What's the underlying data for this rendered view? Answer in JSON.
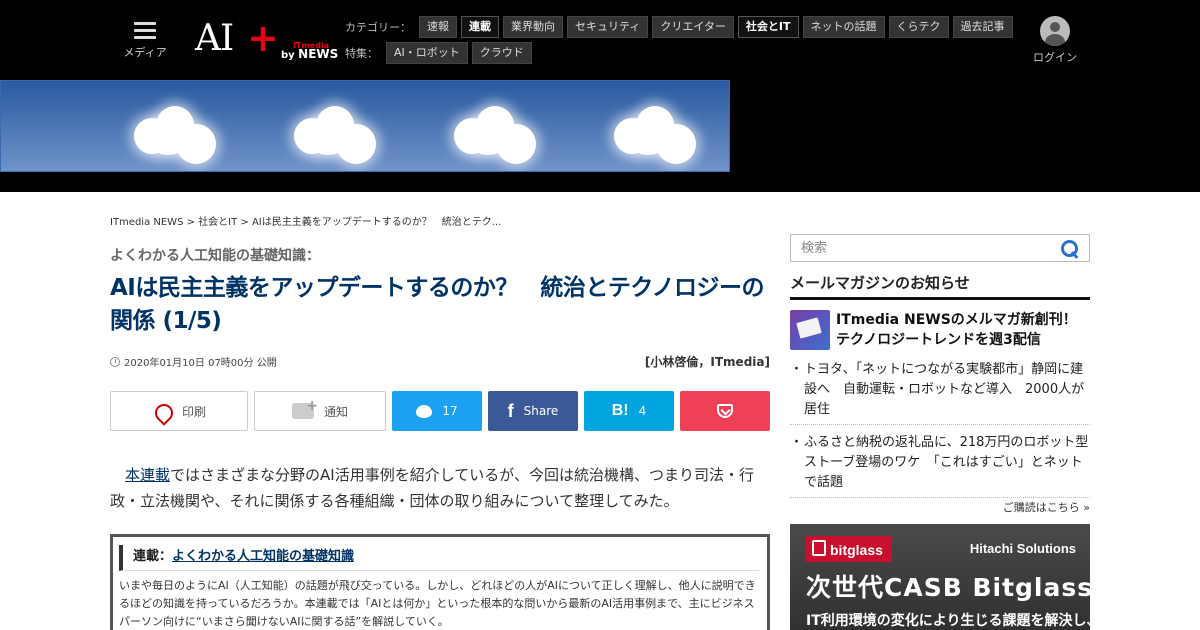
{
  "header": {
    "menu_label": "メディア",
    "logo": {
      "main": "AI",
      "plus": "+",
      "sub_top": "ITmedia",
      "sub_by": "by",
      "sub_news": "NEWS"
    },
    "nav_category_label": "カテゴリー：",
    "nav_categories": [
      {
        "label": "速報",
        "active": false
      },
      {
        "label": "連載",
        "active": true
      },
      {
        "label": "業界動向",
        "active": false
      },
      {
        "label": "セキュリティ",
        "active": false
      },
      {
        "label": "クリエイター",
        "active": false
      },
      {
        "label": "社会とIT",
        "active": true
      },
      {
        "label": "ネットの話題",
        "active": false
      },
      {
        "label": "くらテク",
        "active": false
      },
      {
        "label": "過去記事",
        "active": false
      }
    ],
    "nav_feature_label": "特集：",
    "nav_features": [
      {
        "label": "AI・ロボット"
      },
      {
        "label": "クラウド"
      }
    ],
    "login_label": "ログイン"
  },
  "breadcrumb": "ITmedia NEWS > 社会とIT > AIは民主主義をアップデートするのか？　統治とテク...",
  "article": {
    "series_label": "よくわかる人工知能の基礎知識：",
    "title": "AIは民主主義をアップデートするのか？　統治とテクノロジーの関係 (1/5)",
    "date": "2020年01月10日 07時00分 公開",
    "author": "[小林啓倫，ITmedia]",
    "share": {
      "print": "印刷",
      "notify": "通知",
      "twitter_count": "17",
      "facebook": "Share",
      "hatena_count": "4"
    },
    "lead_link": "本連載",
    "lead_rest": "ではさまざまな分野のAI活用事例を紹介しているが、今回は統治機構、つまり司法・行政・立法機関や、それに関係する各種組織・団体の取り組みについて整理してみた。",
    "series_box": {
      "head_prefix": "連載：",
      "head_link": "よくわかる人工知能の基礎知識",
      "desc": "いまや毎日のようにAI（人工知能）の話題が飛び交っている。しかし、どれほどの人がAIについて正しく理解し、他人に説明できるほどの知識を持っているだろうか。本連載では「AIとは何か」といった根本的な問いから最新のAI活用事例まで、主にビジネスパーソン向けに“いまさら聞けないAIに関する話”を解説していく。"
    }
  },
  "sidebar": {
    "search_placeholder": "検索",
    "mailmag_title": "メールマガジンのお知らせ",
    "mailmag_feature": "ITmedia NEWSのメルマガ新創刊！ テクノロジートレンドを週3配信",
    "mailmag_items": [
      "トヨタ、「ネットにつながる実験都市」静岡に建設へ　自動運転・ロボットなど導入　2000人が居住",
      "ふるさと納税の返礼品に、218万円のロボット型ストーブ登場のワケ　「これはすごい」とネットで話題"
    ],
    "mailmag_more": "ご購読はこちら »",
    "ad": {
      "brand": "bitglass",
      "vendor": "Hitachi Solutions",
      "headline": "次世代CASB Bitglass",
      "sub": "IT利用環境の変化により生じる課題を解決し、"
    }
  },
  "colors": {
    "header_bg": "#000000",
    "title": "#003366",
    "twitter": "#1da1f2",
    "facebook": "#3b5998",
    "hatena": "#00a4de",
    "pocket": "#ef4056",
    "brand_red": "#e60012"
  },
  "icons": [
    "hamburger-icon",
    "user-avatar-icon",
    "pdf-icon",
    "notify-bell-icon",
    "twitter-icon",
    "facebook-icon",
    "hatena-icon",
    "pocket-icon",
    "search-icon",
    "clock-icon",
    "mail-envelope-icon"
  ]
}
